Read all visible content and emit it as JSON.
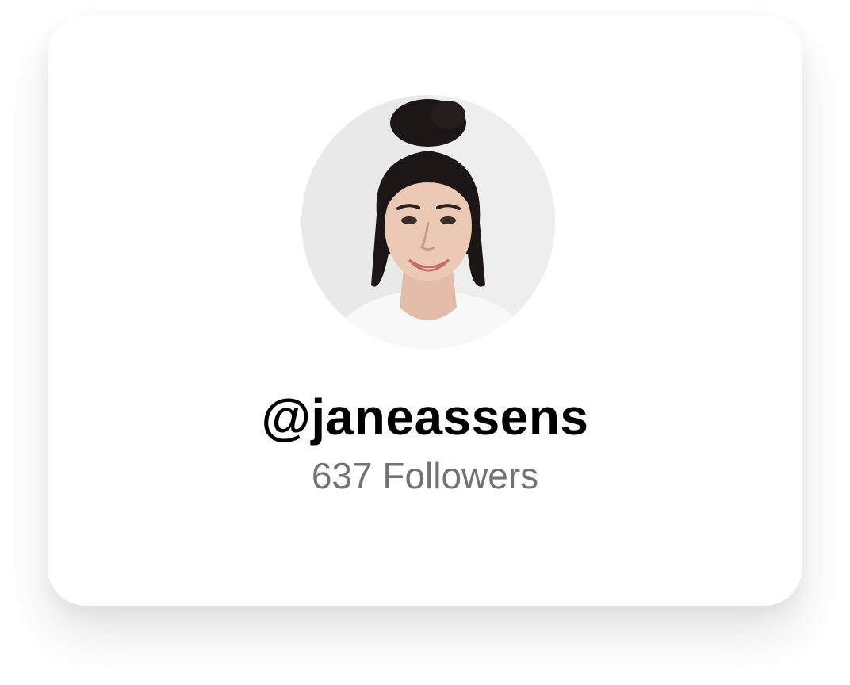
{
  "profile": {
    "handle": "@janeassens",
    "followers_text": "637 Followers",
    "avatar": "avatar-photo"
  },
  "colors": {
    "card_background": "#ffffff",
    "handle_text": "#000000",
    "followers_text": "#737373"
  }
}
